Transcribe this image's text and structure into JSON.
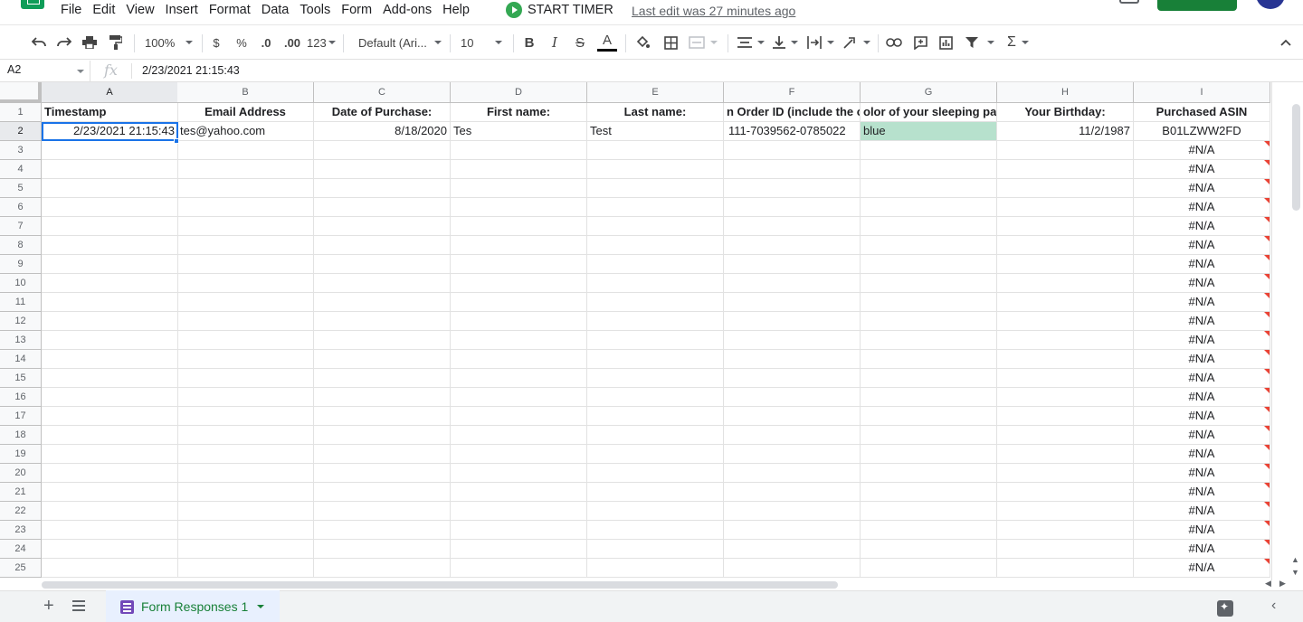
{
  "menu": [
    "File",
    "Edit",
    "View",
    "Insert",
    "Format",
    "Data",
    "Tools",
    "Form",
    "Add-ons",
    "Help"
  ],
  "timer_label": "START TIMER",
  "last_edit": "Last edit was 27 minutes ago",
  "toolbar": {
    "zoom": "100%",
    "currency": "$",
    "percent": "%",
    "dec_less": ".0",
    "dec_more": ".00",
    "more_formats": "123",
    "font": "Default (Ari...",
    "font_size": "10",
    "bold": "B",
    "italic": "I",
    "strike": "S",
    "text_color": "A",
    "sum": "Σ"
  },
  "formula_bar": {
    "cell_ref": "A2",
    "fx": "fx",
    "value": "2/23/2021 21:15:43"
  },
  "columns": [
    "A",
    "B",
    "C",
    "D",
    "E",
    "F",
    "G",
    "H",
    "I"
  ],
  "headers": [
    "Timestamp",
    "Email Address",
    "Date of Purchase:",
    "First name:",
    "Last name:",
    "n Order ID (include the c",
    "olor of your sleeping pa",
    "Your Birthday:",
    "Purchased ASIN"
  ],
  "row2": [
    "2/23/2021 21:15:43",
    "tes@yahoo.com",
    "8/18/2020",
    "Tes",
    "Test",
    "111-7039562-0785022",
    "blue",
    "11/2/1987",
    "B01LZWW2FD"
  ],
  "row_numbers": [
    "1",
    "2",
    "3",
    "4",
    "5",
    "6",
    "7",
    "8",
    "9",
    "10",
    "11",
    "12",
    "13",
    "14",
    "15",
    "16",
    "17",
    "18",
    "19",
    "20",
    "21",
    "22",
    "23",
    "24",
    "25"
  ],
  "na_value": "#N/A",
  "sheet_tab": "Form Responses 1",
  "colors": {
    "accent": "#1a73e8",
    "green_cell": "#b7e1cd",
    "tab_text": "#188038",
    "error_corner": "#ea4335"
  }
}
